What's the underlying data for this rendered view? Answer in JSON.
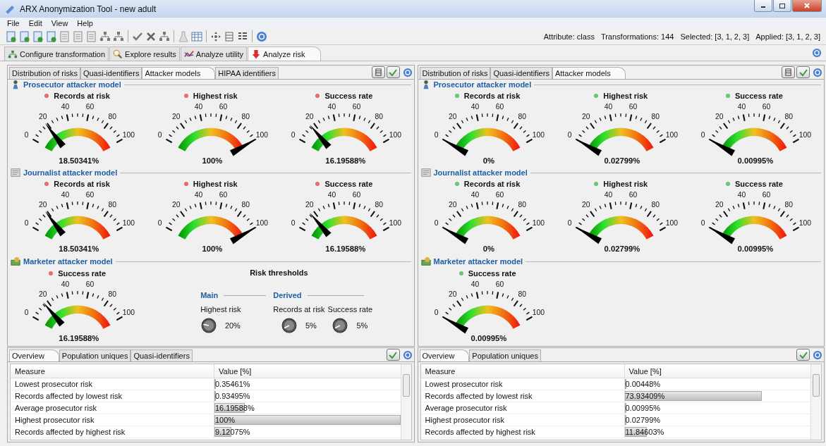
{
  "window": {
    "title": "ARX Anonymization Tool - new adult"
  },
  "menu": [
    "File",
    "Edit",
    "View",
    "Help"
  ],
  "status": [
    "Attribute: class",
    "Transformations: 144",
    "Selected: [3, 1, 2, 3]",
    "Applied: [3, 1, 2, 3]"
  ],
  "main_tabs": [
    {
      "label": "Configure transformation",
      "kind": "tree",
      "selected": false
    },
    {
      "label": "Explore results",
      "kind": "search",
      "selected": false
    },
    {
      "label": "Analyze utility",
      "kind": "chart",
      "selected": false
    },
    {
      "label": "Analyze risk",
      "kind": "risk",
      "selected": true
    }
  ],
  "panels": [
    {
      "tabs": [
        {
          "label": "Distribution of risks",
          "selected": false
        },
        {
          "label": "Quasi-identifiers",
          "selected": false
        },
        {
          "label": "Attacker models",
          "selected": true
        },
        {
          "label": "HIPAA identifiers",
          "selected": false
        }
      ],
      "sections": [
        {
          "title": "Prosecutor attacker model",
          "kind": "prosecutor",
          "gauges": [
            {
              "label": "Records at risk",
              "color": "#e86a6a",
              "reading": "18.50341%",
              "ticks": [
                "0",
                "20",
                "40",
                "60",
                "80",
                "100"
              ]
            },
            {
              "label": "Highest risk",
              "color": "#e86a6a",
              "reading": "100%",
              "ticks": [
                "0",
                "20",
                "40",
                "60",
                "80",
                "100"
              ]
            },
            {
              "label": "Success rate",
              "color": "#e86a6a",
              "reading": "16.19588%",
              "ticks": [
                "0",
                "20",
                "40",
                "60",
                "80",
                "100"
              ]
            }
          ]
        },
        {
          "title": "Journalist attacker model",
          "kind": "journalist",
          "gauges": [
            {
              "label": "Records at risk",
              "color": "#e86a6a",
              "reading": "18.50341%",
              "ticks": [
                "0",
                "20",
                "40",
                "60",
                "80",
                "100"
              ]
            },
            {
              "label": "Highest risk",
              "color": "#e86a6a",
              "reading": "100%",
              "ticks": [
                "0",
                "20",
                "40",
                "60",
                "80",
                "100"
              ]
            },
            {
              "label": "Success rate",
              "color": "#e86a6a",
              "reading": "16.19588%",
              "ticks": [
                "0",
                "20",
                "40",
                "60",
                "80",
                "100"
              ]
            }
          ]
        },
        {
          "title": "Marketer attacker model",
          "kind": "marketer",
          "gauges": [
            {
              "label": "Success rate",
              "color": "#e86a6a",
              "reading": "16.19588%",
              "ticks": [
                "0",
                "20",
                "40",
                "60",
                "80",
                "100"
              ]
            }
          ],
          "thresholds": {
            "title": "Risk thresholds",
            "groups": [
              {
                "title": "Main",
                "knobs": [
                  {
                    "label": "Highest risk",
                    "value": "20%"
                  }
                ]
              },
              {
                "title": "Derived",
                "knobs": [
                  {
                    "label": "Records at risk",
                    "value": "5%"
                  },
                  {
                    "label": "Success rate",
                    "value": "5%"
                  }
                ]
              }
            ]
          }
        }
      ],
      "table": {
        "tabs": [
          {
            "label": "Overview",
            "selected": true
          },
          {
            "label": "Population uniques",
            "selected": false
          },
          {
            "label": "Quasi-identifiers",
            "selected": false
          }
        ],
        "columns": [
          "Measure",
          "Value [%]"
        ],
        "rows": [
          {
            "measure": "Lowest prosecutor risk",
            "value": "0.35461%",
            "level": 0.0035461
          },
          {
            "measure": "Records affected by lowest risk",
            "value": "0.93495%",
            "level": 0.0093495
          },
          {
            "measure": "Average prosecutor risk",
            "value": "16.19588%",
            "level": 0.1619588
          },
          {
            "measure": "Highest prosecutor risk",
            "value": "100%",
            "level": 1
          },
          {
            "measure": "Records affected by highest risk",
            "value": "9.12075%",
            "level": 0.0912075
          }
        ]
      }
    },
    {
      "tabs": [
        {
          "label": "Distribution of risks",
          "selected": false
        },
        {
          "label": "Quasi-identifiers",
          "selected": false
        },
        {
          "label": "Attacker models",
          "selected": true
        }
      ],
      "sections": [
        {
          "title": "Prosecutor attacker model",
          "kind": "prosecutor",
          "gauges": [
            {
              "label": "Records at risk",
              "color": "#6cc46c",
              "reading": "0%",
              "ticks": [
                "0",
                "20",
                "40",
                "60",
                "80",
                "100"
              ]
            },
            {
              "label": "Highest risk",
              "color": "#6cc46c",
              "reading": "0.02799%",
              "ticks": [
                "0",
                "20",
                "40",
                "60",
                "80",
                "100"
              ]
            },
            {
              "label": "Success rate",
              "color": "#6cc46c",
              "reading": "0.00995%",
              "ticks": [
                "0",
                "20",
                "40",
                "60",
                "80",
                "100"
              ]
            }
          ]
        },
        {
          "title": "Journalist attacker model",
          "kind": "journalist",
          "gauges": [
            {
              "label": "Records at risk",
              "color": "#6cc46c",
              "reading": "0%",
              "ticks": [
                "0",
                "20",
                "40",
                "60",
                "80",
                "100"
              ]
            },
            {
              "label": "Highest risk",
              "color": "#6cc46c",
              "reading": "0.02799%",
              "ticks": [
                "0",
                "20",
                "40",
                "60",
                "80",
                "100"
              ]
            },
            {
              "label": "Success rate",
              "color": "#6cc46c",
              "reading": "0.00995%",
              "ticks": [
                "0",
                "20",
                "40",
                "60",
                "80",
                "100"
              ]
            }
          ]
        },
        {
          "title": "Marketer attacker model",
          "kind": "marketer",
          "gauges": [
            {
              "label": "Success rate",
              "color": "#6cc46c",
              "reading": "0.00995%",
              "ticks": [
                "0",
                "20",
                "40",
                "60",
                "80",
                "100"
              ]
            }
          ]
        }
      ],
      "table": {
        "tabs": [
          {
            "label": "Overview",
            "selected": true
          },
          {
            "label": "Population uniques",
            "selected": false
          }
        ],
        "columns": [
          "Measure",
          "Value [%]"
        ],
        "rows": [
          {
            "measure": "Lowest prosecutor risk",
            "value": "0.00448%",
            "level": 4.48e-05
          },
          {
            "measure": "Records affected by lowest risk",
            "value": "73.93409%",
            "level": 0.7393409
          },
          {
            "measure": "Average prosecutor risk",
            "value": "0.00995%",
            "level": 9.95e-05
          },
          {
            "measure": "Highest prosecutor risk",
            "value": "0.02799%",
            "level": 0.0002799
          },
          {
            "measure": "Records affected by highest risk",
            "value": "11.84603%",
            "level": 0.1184603
          }
        ]
      }
    }
  ]
}
